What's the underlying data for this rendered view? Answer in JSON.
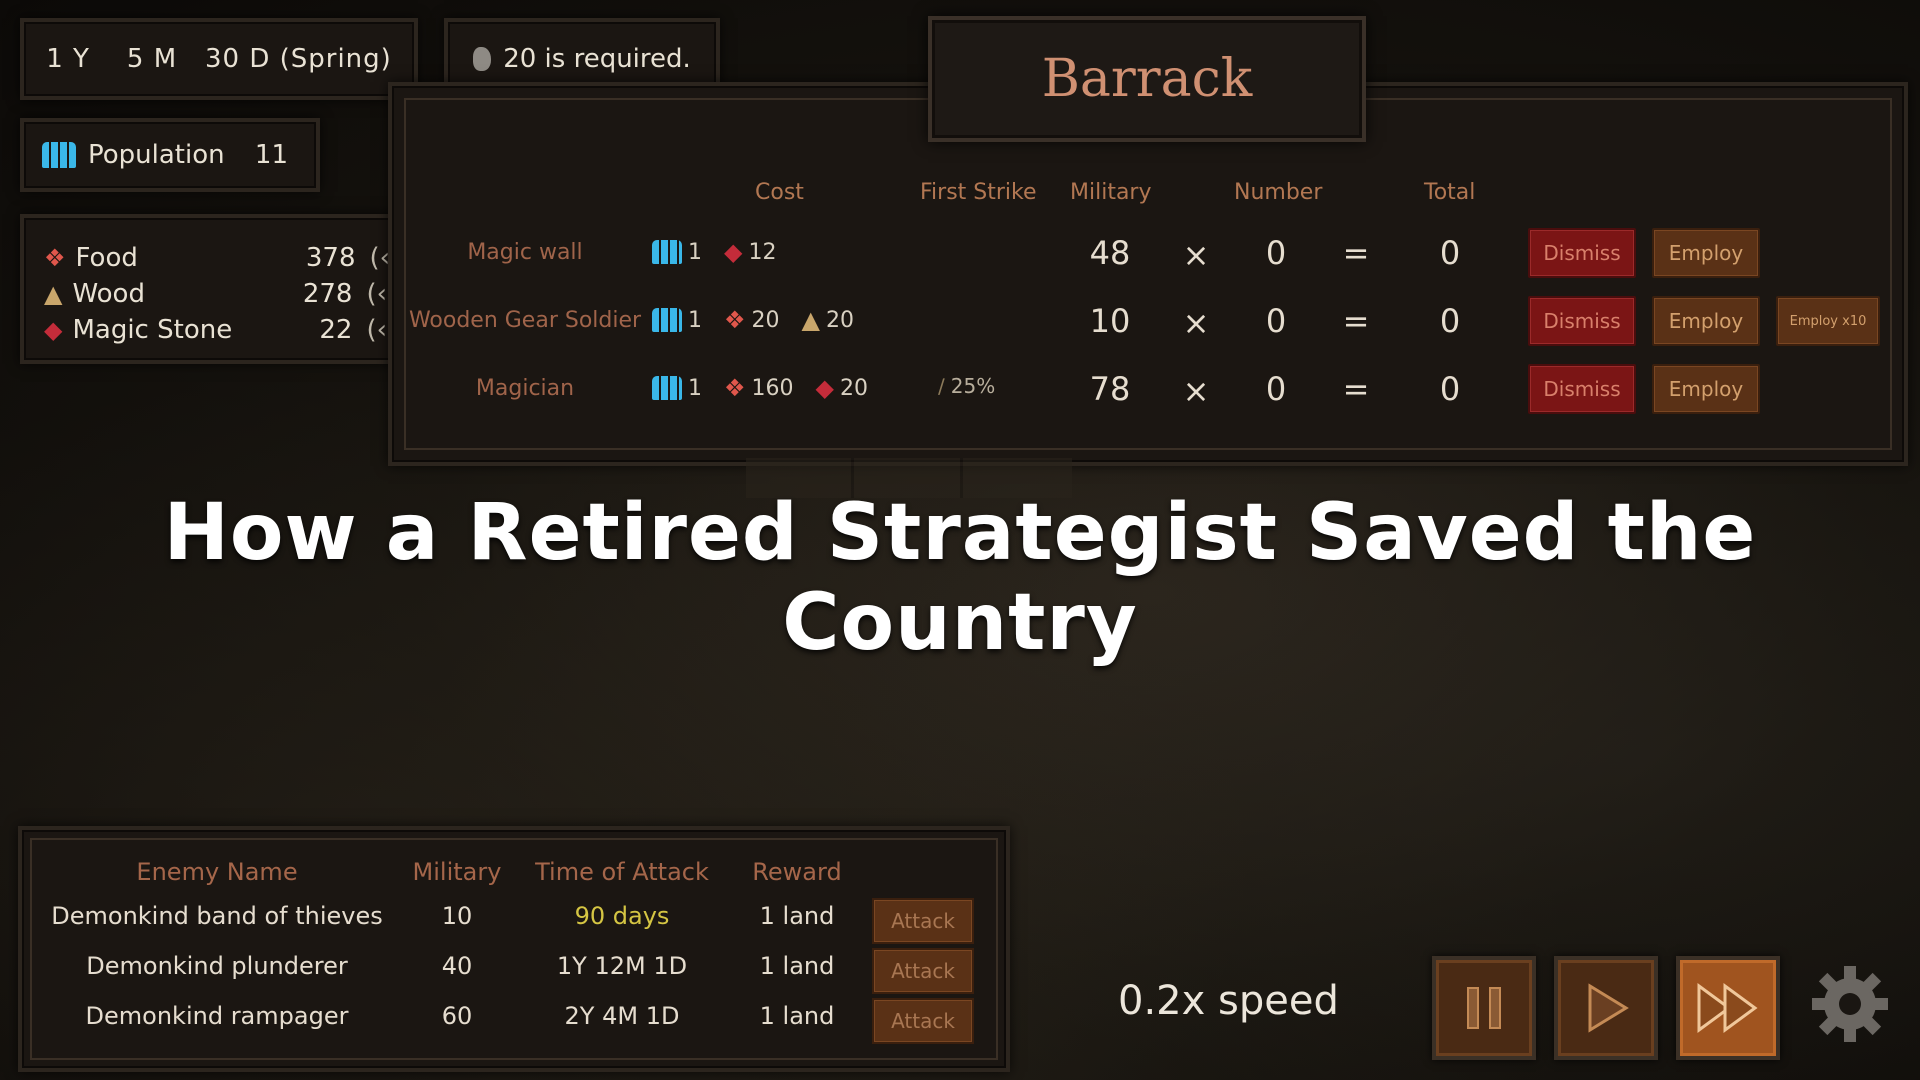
{
  "hud": {
    "date": "1 Y    5 M   30 D (Spring)",
    "required": "20 is required.",
    "population_label": "Population",
    "population_value": "11",
    "resources": [
      {
        "name": "Food",
        "value": "378",
        "rate": "(‹"
      },
      {
        "name": "Wood",
        "value": "278",
        "rate": "(‹"
      },
      {
        "name": "Magic Stone",
        "value": "22",
        "rate": "(‹"
      }
    ]
  },
  "barrack": {
    "title": "Barrack",
    "headers": {
      "cost": "Cost",
      "first_strike": "First Strike",
      "military": "Military",
      "number": "Number",
      "total": "Total"
    },
    "units": [
      {
        "name": "Magic wall",
        "pop": "1",
        "cost1": "12",
        "cost2": "",
        "first_strike": "",
        "military": "48",
        "times": "×",
        "number": "0",
        "eq": "=",
        "total": "0",
        "dismiss": "Dismiss",
        "employ": "Employ",
        "employ10": ""
      },
      {
        "name": "Wooden Gear Soldier",
        "pop": "1",
        "cost1": "20",
        "cost2": "20",
        "first_strike": "",
        "military": "10",
        "times": "×",
        "number": "0",
        "eq": "=",
        "total": "0",
        "dismiss": "Dismiss",
        "employ": "Employ",
        "employ10": "Employ x10"
      },
      {
        "name": "Magician",
        "pop": "1",
        "cost1": "160",
        "cost2": "20",
        "first_strike": "25%",
        "military": "78",
        "times": "×",
        "number": "0",
        "eq": "=",
        "total": "0",
        "dismiss": "Dismiss",
        "employ": "Employ",
        "employ10": ""
      }
    ]
  },
  "headline": "How a Retired Strategist Saved the Country",
  "enemies": {
    "headers": {
      "name": "Enemy Name",
      "military": "Military",
      "time": "Time of Attack",
      "reward": "Reward"
    },
    "rows": [
      {
        "name": "Demonkind band of thieves",
        "military": "10",
        "time": "90 days",
        "reward": "1 land",
        "action": "Attack"
      },
      {
        "name": "Demonkind plunderer",
        "military": "40",
        "time": "1Y 12M 1D",
        "reward": "1 land",
        "action": "Attack"
      },
      {
        "name": "Demonkind rampager",
        "military": "60",
        "time": "2Y 4M 1D",
        "reward": "1 land",
        "action": "Attack"
      }
    ]
  },
  "controls": {
    "speed": "0.2x speed",
    "icons": [
      "pause-icon",
      "play-icon",
      "fast-forward-icon",
      "gear-icon"
    ]
  },
  "colors": {
    "dismiss": "#7b1515",
    "employ": "#5a3116",
    "header_text": "#b27752",
    "days_highlight": "#d5c543",
    "population_icon": "#3ab7e8"
  }
}
